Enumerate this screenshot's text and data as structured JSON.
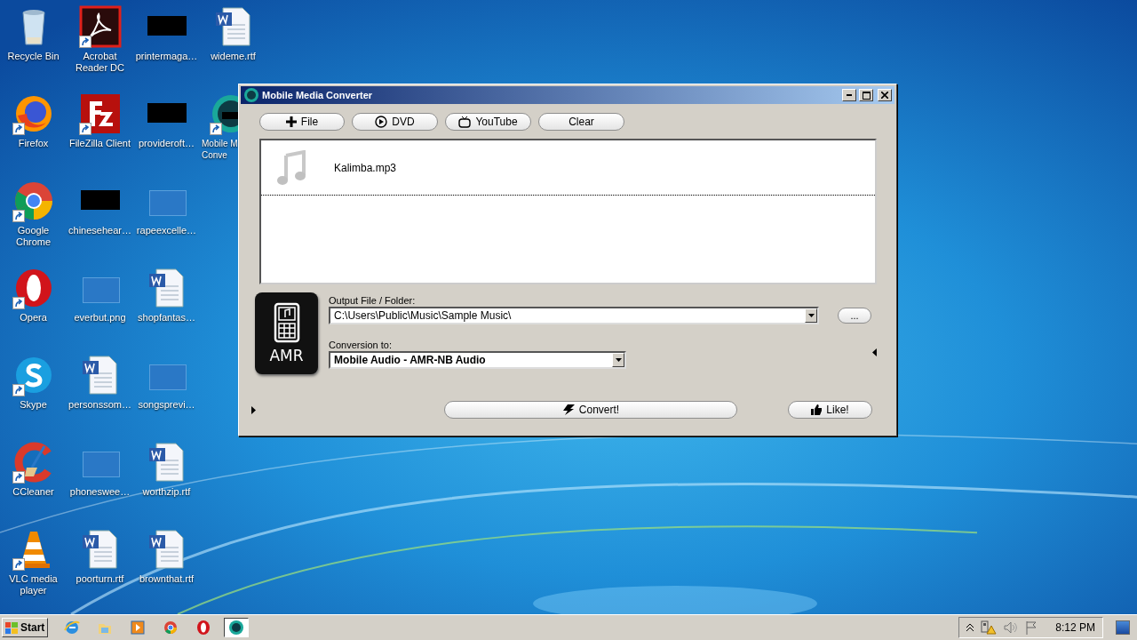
{
  "desktop": {
    "icons": [
      {
        "label": "Recycle Bin",
        "kind": "recycle",
        "shortcut": false
      },
      {
        "label": "Firefox",
        "kind": "firefox",
        "shortcut": true
      },
      {
        "label": "Google Chrome",
        "kind": "chrome",
        "shortcut": true
      },
      {
        "label": "Opera",
        "kind": "opera",
        "shortcut": true
      },
      {
        "label": "Skype",
        "kind": "skype",
        "shortcut": true
      },
      {
        "label": "CCleaner",
        "kind": "ccleaner",
        "shortcut": true
      },
      {
        "label": "VLC media player",
        "kind": "vlc",
        "shortcut": true
      },
      {
        "label": "Acrobat Reader DC",
        "kind": "acrobat",
        "shortcut": true
      },
      {
        "label": "FileZilla Client",
        "kind": "filezilla",
        "shortcut": true
      },
      {
        "label": "chinesehear…",
        "kind": "black",
        "shortcut": false
      },
      {
        "label": "everbut.png",
        "kind": "blank",
        "shortcut": false
      },
      {
        "label": "personssom…",
        "kind": "word",
        "shortcut": false
      },
      {
        "label": "phoneswee…",
        "kind": "blank",
        "shortcut": false
      },
      {
        "label": "poorturn.rtf",
        "kind": "word",
        "shortcut": false
      },
      {
        "label": "printermaga…",
        "kind": "black",
        "shortcut": false
      },
      {
        "label": "provideroft…",
        "kind": "black",
        "shortcut": false
      },
      {
        "label": "rapeexcelle…",
        "kind": "blank",
        "shortcut": false
      },
      {
        "label": "shopfantas…",
        "kind": "word",
        "shortcut": false
      },
      {
        "label": "songsprevi…",
        "kind": "blank",
        "shortcut": false
      },
      {
        "label": "worthzip.rtf",
        "kind": "word",
        "shortcut": false
      },
      {
        "label": "brownthat.rtf",
        "kind": "word",
        "shortcut": false
      },
      {
        "label": "wideme.rtf",
        "kind": "word",
        "shortcut": false
      },
      {
        "label": "Mobile M\nConve",
        "kind": "app",
        "shortcut": true
      }
    ]
  },
  "window": {
    "title": "Mobile Media Converter",
    "toolbar": [
      {
        "label": "File",
        "kind": "plus"
      },
      {
        "label": "DVD",
        "kind": "play"
      },
      {
        "label": "YouTube",
        "kind": "tv"
      },
      {
        "label": "Clear",
        "kind": "none"
      }
    ],
    "files": [
      {
        "name": "Kalimba.mp3"
      }
    ],
    "format_badge": "AMR",
    "output": {
      "label": "Output File / Folder:",
      "value": "C:\\Users\\Public\\Music\\Sample Music\\",
      "browse": "..."
    },
    "conversion": {
      "label": "Conversion to:",
      "value": "Mobile Audio - AMR-NB Audio"
    },
    "convert": "Convert!",
    "like": "Like!"
  },
  "taskbar": {
    "start": "Start",
    "apps": [
      {
        "kind": "ie",
        "selected": false
      },
      {
        "kind": "explorer",
        "selected": false
      },
      {
        "kind": "media",
        "selected": false
      },
      {
        "kind": "chrome",
        "selected": false
      },
      {
        "kind": "opera",
        "selected": false
      },
      {
        "kind": "app",
        "selected": true
      }
    ],
    "clock": "8:12 PM"
  }
}
